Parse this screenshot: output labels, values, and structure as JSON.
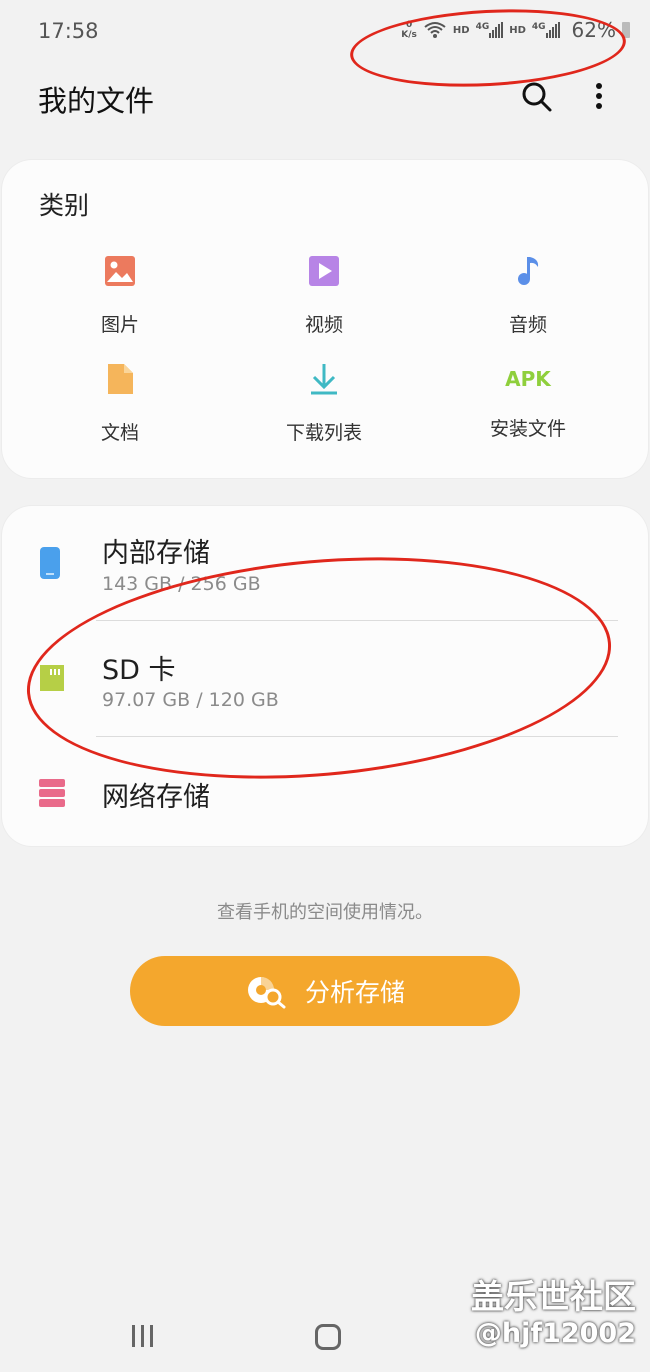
{
  "status_bar": {
    "time": "17:58",
    "net_speed_value": "0",
    "net_speed_unit": "K/s",
    "hd1": "HD",
    "lte1": "4G",
    "hd2": "HD",
    "lte2": "4G",
    "battery": "62%"
  },
  "header": {
    "title": "我的文件",
    "search_icon": "search-icon",
    "more_icon": "more-vertical-icon"
  },
  "categories": {
    "heading": "类别",
    "items": [
      {
        "label": "图片",
        "icon": "image-icon",
        "color": "#ec7a5e"
      },
      {
        "label": "视频",
        "icon": "video-icon",
        "color": "#b784e6"
      },
      {
        "label": "音频",
        "icon": "audio-icon",
        "color": "#5b8fe8"
      },
      {
        "label": "文档",
        "icon": "document-icon",
        "color": "#f5b55b"
      },
      {
        "label": "下载列表",
        "icon": "download-icon",
        "color": "#3fb9c4"
      },
      {
        "label": "安装文件",
        "icon": "apk-icon",
        "icon_text": "APK",
        "color": "#8fcf3c"
      }
    ]
  },
  "storage": {
    "internal": {
      "name": "内部存储",
      "usage": "143 GB / 256 GB",
      "color": "#4aa0ec"
    },
    "sd": {
      "name": "SD 卡",
      "usage": "97.07 GB / 120 GB",
      "color": "#b6cf46"
    },
    "network": {
      "name": "网络存储",
      "color": "#e96a8a"
    }
  },
  "analyze": {
    "hint": "查看手机的空间使用情况。",
    "button_label": "分析存储"
  },
  "watermark": {
    "line1": "盖乐世社区",
    "line2": "@hjf12002"
  },
  "colors": {
    "accent": "#f4a72d",
    "annotation": "#e0271c"
  }
}
